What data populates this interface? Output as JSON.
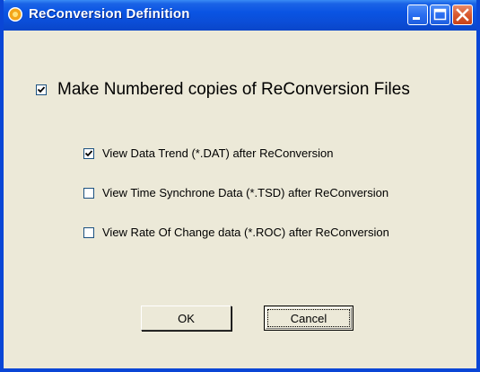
{
  "window": {
    "title": "ReConversion Definition"
  },
  "options": {
    "main": {
      "label": "Make Numbered copies of ReConversion Files",
      "checked": true
    },
    "items": [
      {
        "label": "View Data Trend  (*.DAT) after ReConversion",
        "checked": true
      },
      {
        "label": "View Time Synchrone Data  (*.TSD) after ReConversion",
        "checked": false
      },
      {
        "label": "View Rate Of Change data  (*.ROC) after ReConversion",
        "checked": false
      }
    ]
  },
  "buttons": {
    "ok_label": "OK",
    "cancel_label": "Cancel"
  },
  "icons": {
    "app": "app-icon",
    "minimize": "minimize-icon",
    "maximize": "maximize-icon",
    "close": "close-icon",
    "check": "checkmark-icon"
  },
  "colors": {
    "titlebar": "#0a54e3",
    "dialog_bg": "#ece9d8",
    "close_button": "#d9592f"
  }
}
